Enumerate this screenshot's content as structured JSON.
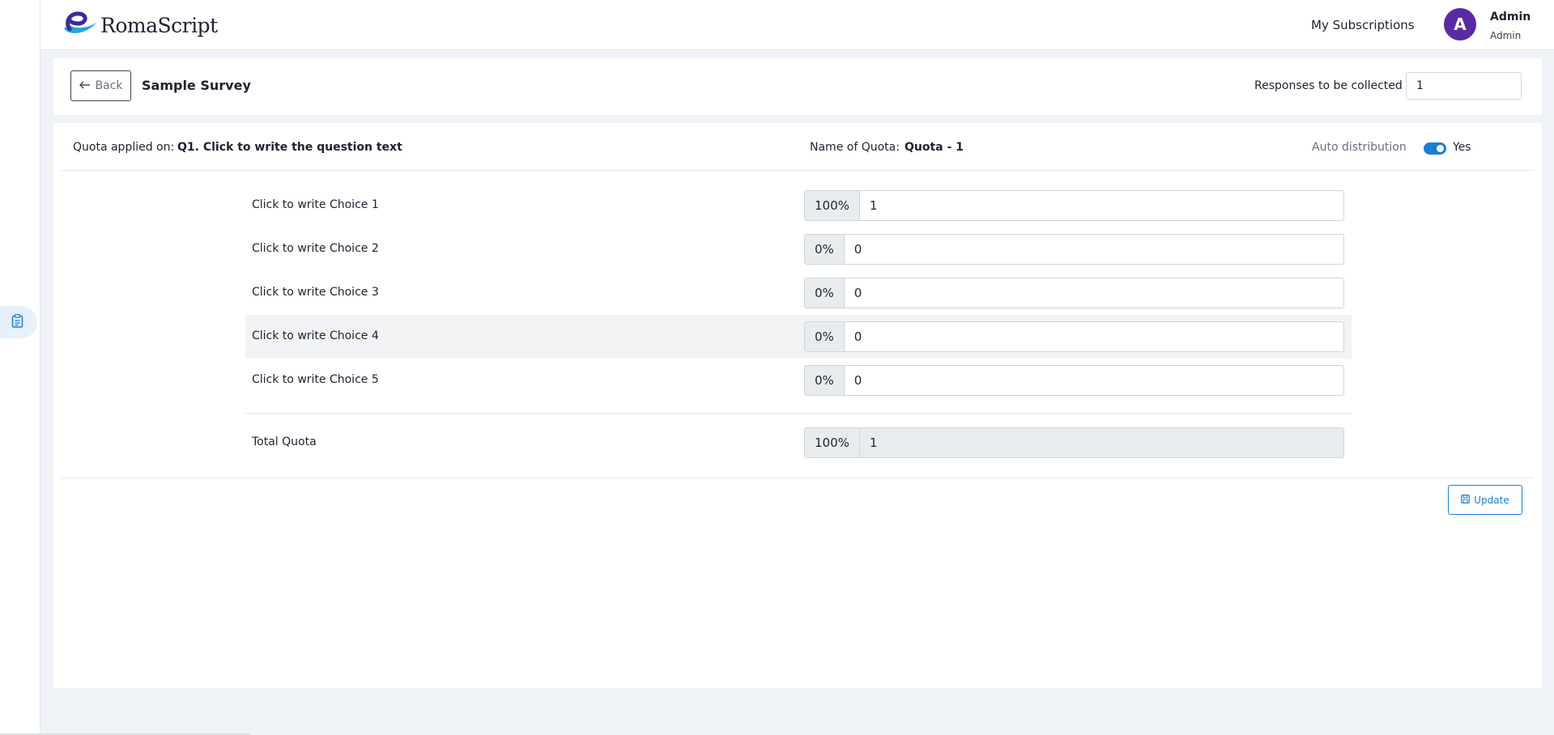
{
  "brand": {
    "name": "RomaScript",
    "accent": "#1a7fd4",
    "avatar_color": "#5a2aa6"
  },
  "header": {
    "subscriptions_label": "My Subscriptions",
    "avatar_initial": "A",
    "user_name": "Admin",
    "user_role": "Admin"
  },
  "sidebar": {
    "active_icon": "clipboard-icon"
  },
  "toolbar": {
    "back_label": "Back",
    "survey_title": "Sample Survey",
    "responses_label": "Responses to be collected",
    "responses_value": "1"
  },
  "quota": {
    "applied_on_label": "Quota applied on:",
    "question_text": "Q1. Click to write the question text",
    "name_label": "Name of Quota:",
    "name_value": "Quota - 1",
    "auto_distribution_label": "Auto distribution",
    "auto_distribution_on": true,
    "auto_distribution_value": "Yes",
    "choices": [
      {
        "label": "Click to write Choice 1",
        "percent": "100%",
        "value": "1"
      },
      {
        "label": "Click to write Choice 2",
        "percent": "0%",
        "value": "0"
      },
      {
        "label": "Click to write Choice 3",
        "percent": "0%",
        "value": "0"
      },
      {
        "label": "Click to write Choice 4",
        "percent": "0%",
        "value": "0"
      },
      {
        "label": "Click to write Choice 5",
        "percent": "0%",
        "value": "0"
      }
    ],
    "total_label": "Total Quota",
    "total_percent": "100%",
    "total_value": "1",
    "update_label": "Update"
  }
}
